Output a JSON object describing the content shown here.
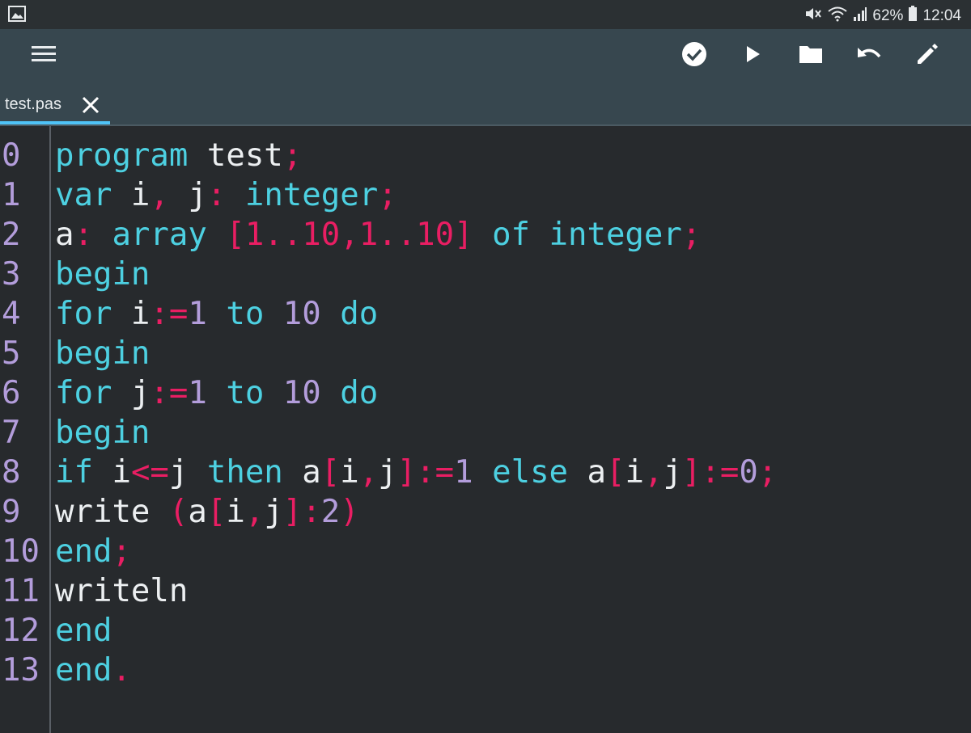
{
  "status_bar": {
    "battery": "62%",
    "time": "12:04"
  },
  "toolbar": {
    "icons": [
      "menu-icon",
      "check-circle-icon",
      "play-icon",
      "folder-icon",
      "undo-icon",
      "edit-pencil-icon"
    ]
  },
  "tabs": [
    {
      "label": "test.pas",
      "active": true
    }
  ],
  "colors": {
    "keyword": "#4dd0e1",
    "operator": "#e91e63",
    "number": "#b39ddb",
    "identifier": "#eceff1",
    "toolbar": "#37474f",
    "tab_indicator": "#4fc3f7",
    "editor_bg": "#272a2d"
  },
  "editor": {
    "line_numbers": [
      "0",
      "1",
      "2",
      "3",
      "4",
      "5",
      "6",
      "7",
      "8",
      "9",
      "10",
      "11",
      "12",
      "13"
    ],
    "lines": [
      [
        [
          "kw",
          "program"
        ],
        [
          "id",
          " test"
        ],
        [
          "op",
          ";"
        ]
      ],
      [
        [
          "kw",
          "var"
        ],
        [
          "id",
          " i"
        ],
        [
          "op",
          ","
        ],
        [
          "id",
          " j"
        ],
        [
          "op",
          ":"
        ],
        [
          "kw",
          " integer"
        ],
        [
          "op",
          ";"
        ]
      ],
      [
        [
          "id",
          "a"
        ],
        [
          "op",
          ":"
        ],
        [
          "kw",
          " array"
        ],
        [
          "op",
          " [1..10,1..10]"
        ],
        [
          "kw",
          " of integer"
        ],
        [
          "op",
          ";"
        ]
      ],
      [
        [
          "kw",
          "begin"
        ]
      ],
      [
        [
          "kw",
          "for"
        ],
        [
          "id",
          " i"
        ],
        [
          "op",
          ":="
        ],
        [
          "num",
          "1"
        ],
        [
          "kw",
          " to"
        ],
        [
          "num",
          " 10"
        ],
        [
          "kw",
          " do"
        ]
      ],
      [
        [
          "kw",
          "begin"
        ]
      ],
      [
        [
          "kw",
          "for"
        ],
        [
          "id",
          " j"
        ],
        [
          "op",
          ":="
        ],
        [
          "num",
          "1"
        ],
        [
          "kw",
          " to"
        ],
        [
          "num",
          " 10"
        ],
        [
          "kw",
          " do"
        ]
      ],
      [
        [
          "kw",
          "begin"
        ]
      ],
      [
        [
          "kw",
          "if"
        ],
        [
          "id",
          " i"
        ],
        [
          "op",
          "<="
        ],
        [
          "id",
          "j"
        ],
        [
          "kw",
          " then"
        ],
        [
          "id",
          " a"
        ],
        [
          "op",
          "["
        ],
        [
          "id",
          "i"
        ],
        [
          "op",
          ","
        ],
        [
          "id",
          "j"
        ],
        [
          "op",
          "]:="
        ],
        [
          "num",
          "1"
        ],
        [
          "kw",
          " else"
        ],
        [
          "id",
          " a"
        ],
        [
          "op",
          "["
        ],
        [
          "id",
          "i"
        ],
        [
          "op",
          ","
        ],
        [
          "id",
          "j"
        ],
        [
          "op",
          "]:="
        ],
        [
          "num",
          "0"
        ],
        [
          "op",
          ";"
        ]
      ],
      [
        [
          "id",
          "write "
        ],
        [
          "op",
          "("
        ],
        [
          "id",
          "a"
        ],
        [
          "op",
          "["
        ],
        [
          "id",
          "i"
        ],
        [
          "op",
          ","
        ],
        [
          "id",
          "j"
        ],
        [
          "op",
          "]:"
        ],
        [
          "num",
          "2"
        ],
        [
          "op",
          ")"
        ]
      ],
      [
        [
          "kw",
          "end"
        ],
        [
          "op",
          ";"
        ]
      ],
      [
        [
          "id",
          "writeln"
        ]
      ],
      [
        [
          "kw",
          "end"
        ]
      ],
      [
        [
          "kw",
          "end"
        ],
        [
          "op",
          "."
        ]
      ]
    ]
  }
}
